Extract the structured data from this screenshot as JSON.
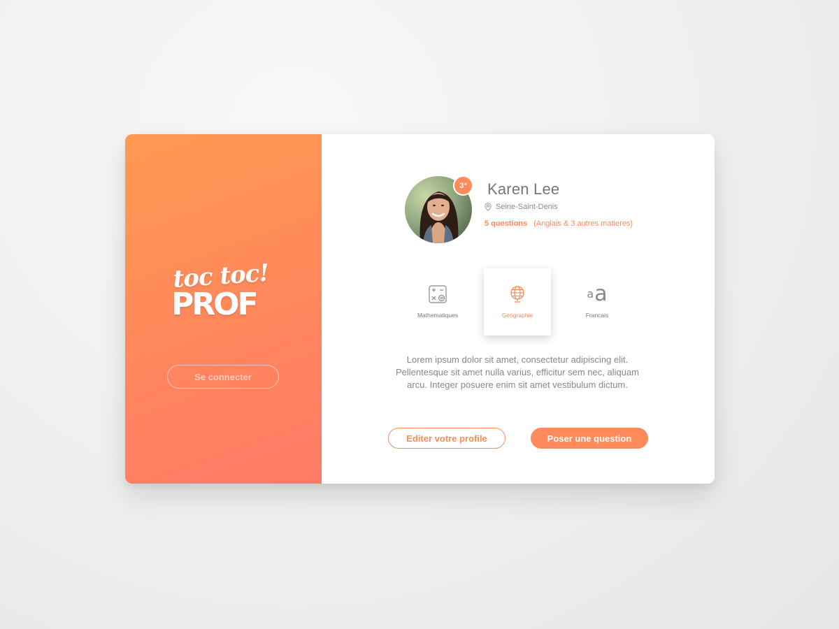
{
  "brand": {
    "logo_top": "toc toc!",
    "logo_bottom": "PROF"
  },
  "left": {
    "connect_label": "Se connecter"
  },
  "profile": {
    "name": "Karen Lee",
    "location": "Seine-Saint-Denis",
    "badge_number": "3",
    "badge_suffix": "e",
    "questions_count": "5 questions",
    "questions_detail": "(Anglais & 3 autres matieres)"
  },
  "subjects": [
    {
      "label": "Mathematiques",
      "icon": "calculator-icon",
      "active": false
    },
    {
      "label": "Geographie",
      "icon": "globe-icon",
      "active": true
    },
    {
      "label": "Francais",
      "icon": "font-size-icon",
      "active": false
    }
  ],
  "description": "Lorem ipsum dolor sit amet, consectetur adipiscing elit. Pellentesque sit amet nulla varius, efficitur sem nec, aliquam arcu. Integer posuere enim sit amet vestibulum dictum.",
  "actions": {
    "edit_label": "Editer votre profile",
    "ask_label": "Poser une question"
  },
  "colors": {
    "accent": "#ff8a5b",
    "gradient_start": "#ff9a52",
    "gradient_end": "#ff7a67"
  }
}
